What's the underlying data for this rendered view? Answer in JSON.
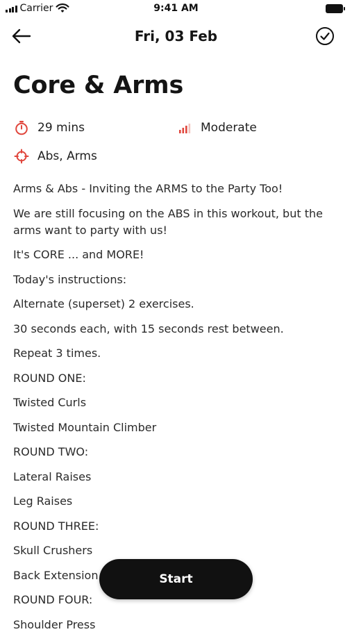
{
  "status_bar": {
    "carrier": "Carrier",
    "time": "9:41 AM"
  },
  "nav": {
    "title": "Fri, 03 Feb",
    "back_icon": "arrow-left-icon",
    "complete_icon": "check-circle-icon"
  },
  "workout": {
    "title": "Core & Arms",
    "duration": "29 mins",
    "intensity": "Moderate",
    "focus": "Abs, Arms",
    "accent_color": "#e0463c",
    "description": [
      "Arms & Abs - Inviting the ARMS to the Party Too!",
      "We are still focusing on the ABS in this workout, but the arms want to party with us!",
      "It's CORE ... and MORE!",
      "Today's instructions:",
      "Alternate (superset) 2 exercises.",
      "30 seconds each, with 15 seconds rest between.",
      "Repeat 3 times.",
      "ROUND ONE:",
      "Twisted Curls",
      "Twisted Mountain Climber",
      "ROUND TWO:",
      "Lateral Raises",
      "Leg Raises",
      "ROUND THREE:",
      "Skull Crushers",
      "Back Extension",
      "ROUND FOUR:",
      "Shoulder Press"
    ]
  },
  "actions": {
    "start_label": "Start"
  }
}
